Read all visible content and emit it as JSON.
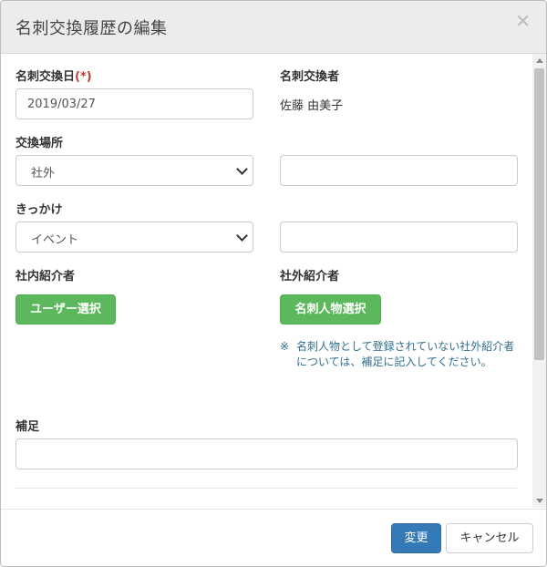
{
  "modal": {
    "title": "名刺交換履歴の編集",
    "close_icon": "close-icon"
  },
  "form": {
    "exchange_date": {
      "label": "名刺交換日",
      "required_mark": "(*)",
      "value": "2019/03/27"
    },
    "exchanger": {
      "label": "名刺交換者",
      "value": "佐藤 由美子"
    },
    "place": {
      "label": "交換場所",
      "selected": "社外",
      "other_value": ""
    },
    "trigger": {
      "label": "きっかけ",
      "selected": "イベント",
      "other_value": ""
    },
    "internal_referrer": {
      "label": "社内紹介者",
      "button": "ユーザー選択"
    },
    "external_referrer": {
      "label": "社外紹介者",
      "button": "名刺人物選択",
      "note_mark": "※",
      "note": "名刺人物として登録されていない社外紹介者については、補足に記入してください。"
    },
    "remarks": {
      "label": "補足",
      "value": ""
    }
  },
  "footer": {
    "submit_label": "変更",
    "cancel_label": "キャンセル"
  },
  "colors": {
    "primary": "#337ab7",
    "success": "#5cb85c",
    "required": "#c0392b",
    "note": "#31708f"
  }
}
